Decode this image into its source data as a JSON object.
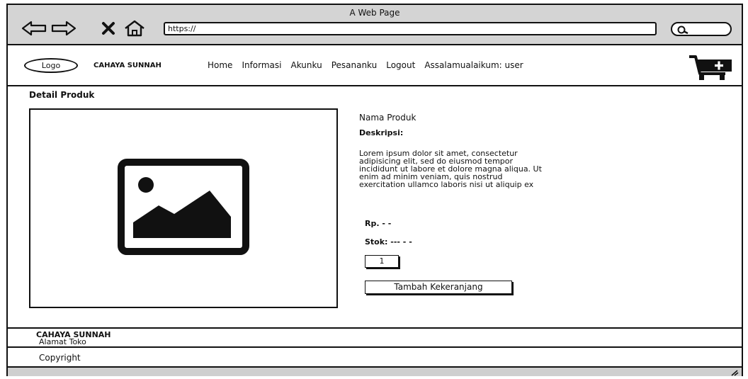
{
  "window": {
    "title": "A Web Page"
  },
  "browser": {
    "url": "https://",
    "back_icon": "arrow-left-icon",
    "forward_icon": "arrow-right-icon",
    "stop_icon": "close-icon",
    "home_icon": "home-icon",
    "search_icon": "search-icon"
  },
  "header": {
    "logo_label": "Logo",
    "brand": "CAHAYA SUNNAH",
    "menu": [
      "Home",
      "Informasi",
      "Akunku",
      "Pesananku",
      "Logout",
      "Assalamualaikum: user"
    ],
    "cart_icon": "cart-add-icon"
  },
  "main": {
    "section_title": "Detail Produk",
    "image_icon": "image-placeholder-icon",
    "product_name": "Nama Produk",
    "description_label": "Deskripsi:",
    "description_lines": [
      "Lorem ipsum dolor sit amet, consectetur",
      "adipisicing elit, sed do eiusmod tempor",
      "incididunt ut labore et dolore magna aliqua. Ut",
      "enim ad minim veniam, quis nostrud",
      "exercitation ullamco laboris nisi ut aliquip ex"
    ],
    "price": "Rp. - -",
    "stock": "Stok: --- - -",
    "quantity": "1",
    "add_to_cart_label": "Tambah Kekeranjang"
  },
  "footer": {
    "brand": "CAHAYA SUNNAH",
    "address": "Alamat Toko",
    "copyright": "Copyright"
  }
}
